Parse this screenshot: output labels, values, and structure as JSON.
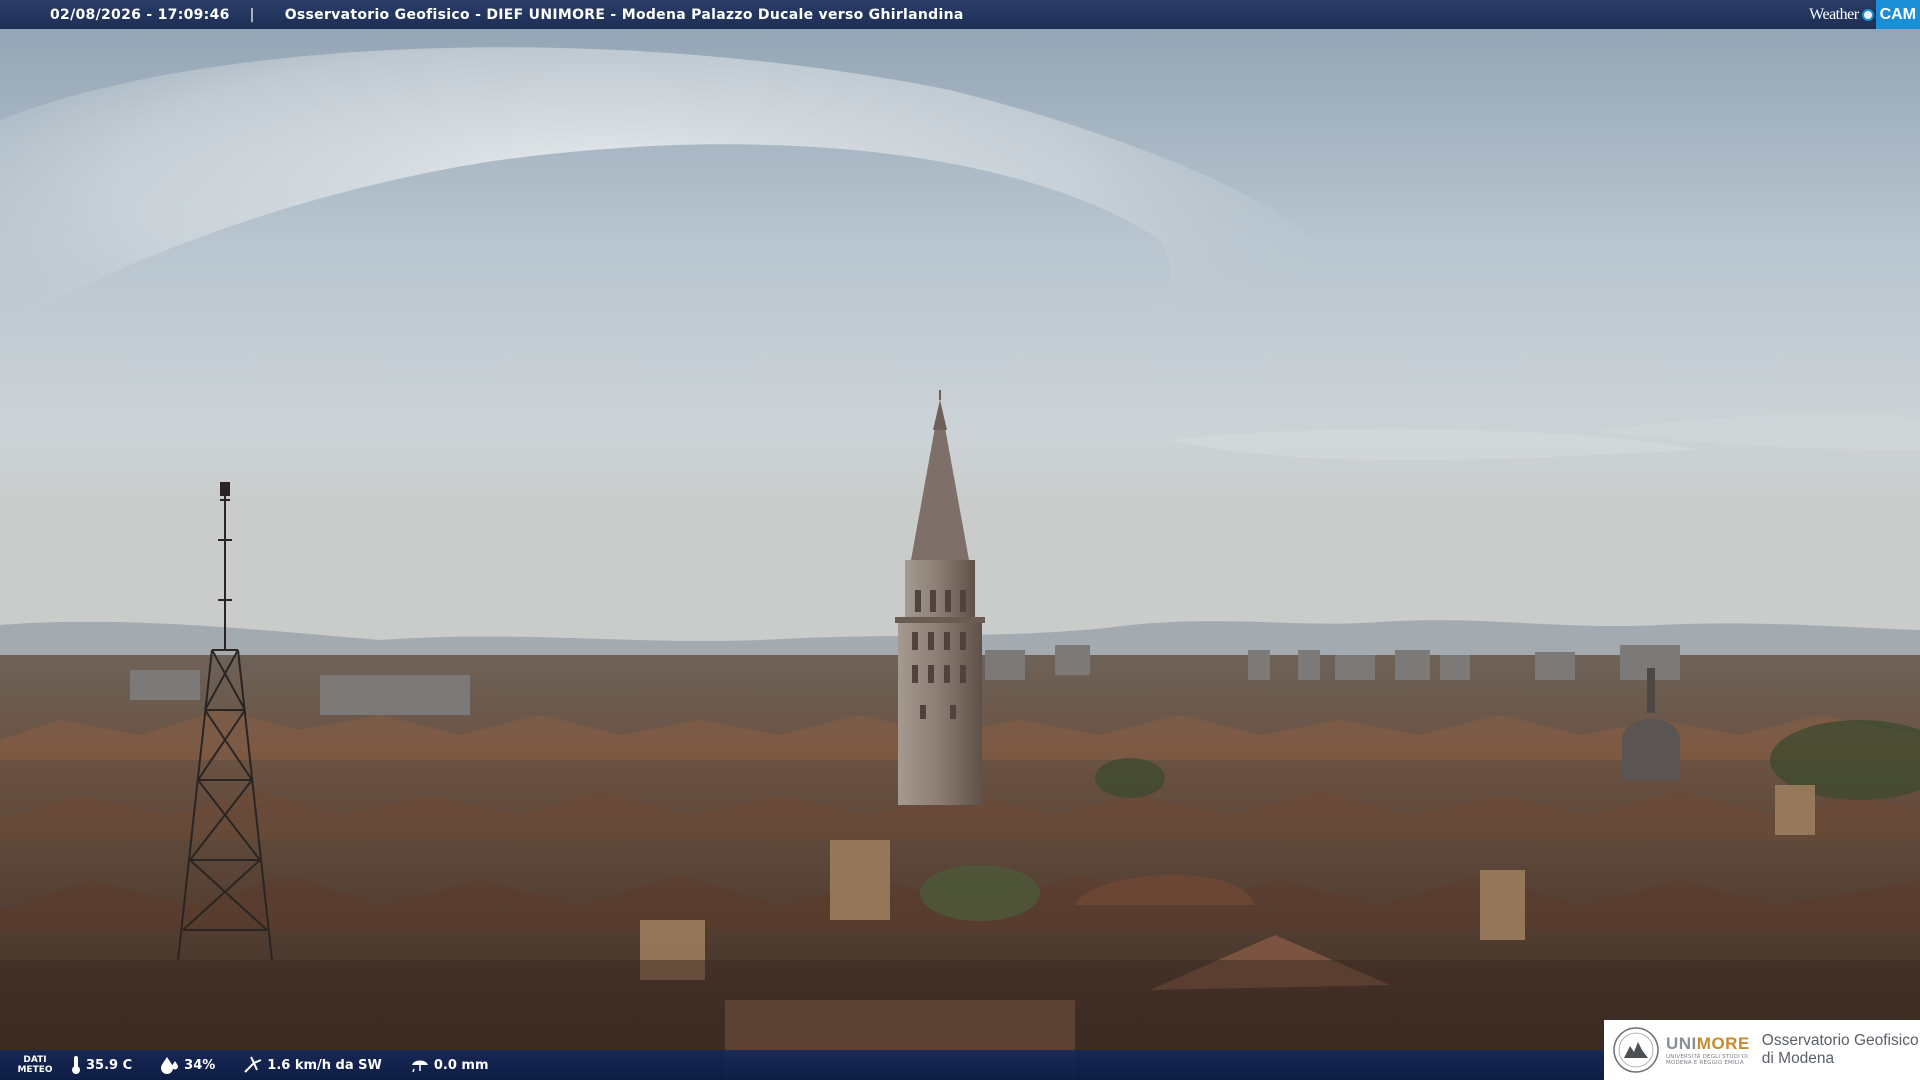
{
  "header": {
    "timestamp": "02/08/2026 - 17:09:46",
    "separator": "|",
    "title": "Osservatorio Geofisico - DIEF UNIMORE - Modena Palazzo Ducale verso Ghirlandina"
  },
  "brand": {
    "weather": "Weather",
    "cam": "CAM",
    "accent": "#1a8fd6"
  },
  "weather": {
    "label_line1": "DATI",
    "label_line2": "METEO",
    "temperature": "35.9 C",
    "humidity": "34%",
    "wind": "1.6 km/h da SW",
    "rain": "0.0 mm",
    "icons": [
      "thermometer-icon",
      "humidity-drop-icon",
      "wind-icon",
      "rain-icon"
    ]
  },
  "logo": {
    "uni_part1": "UNI",
    "uni_part2": "MORE",
    "uni_subtitle_1": "UNIVERSITÀ DEGLI STUDI DI",
    "uni_subtitle_2": "MODENA E REGGIO EMILIA",
    "text_line1": "Osservatorio Geofisico",
    "text_line2": "di Modena",
    "accent": "#c68a2e"
  },
  "colors": {
    "bar": "#1d2f57",
    "sky": "#c8d2da",
    "roof": "#5a4233"
  }
}
